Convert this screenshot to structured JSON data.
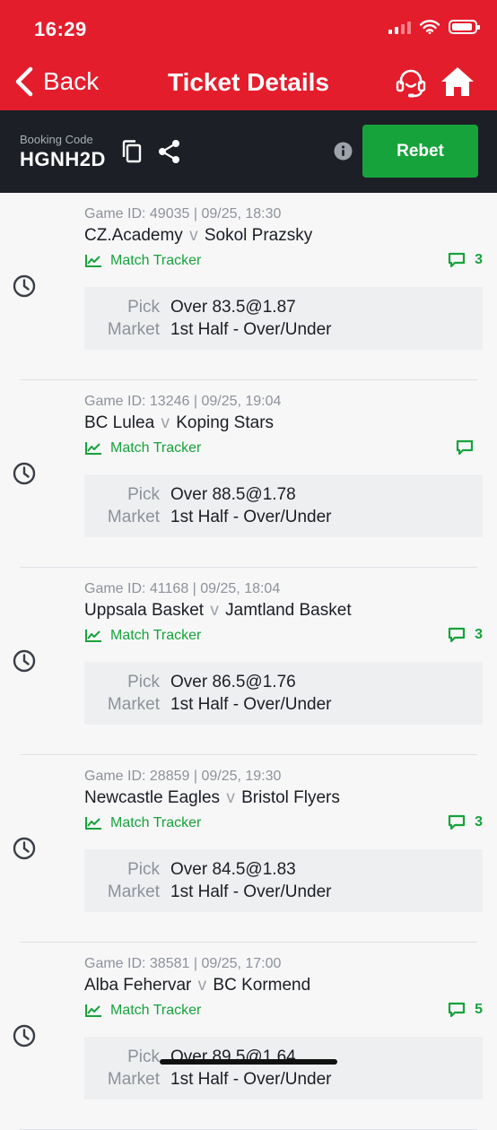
{
  "status_bar": {
    "time": "16:29"
  },
  "header": {
    "back_label": "Back",
    "title": "Ticket Details"
  },
  "booking": {
    "label": "Booking Code",
    "code": "HGNH2D",
    "rebet_label": "Rebet"
  },
  "bets": [
    {
      "meta": "Game ID: 49035 | 09/25, 18:30",
      "home": "CZ.Academy",
      "away": "Sokol Prazsky",
      "tracker": "Match Tracker",
      "comments": "3",
      "pick_label": "Pick",
      "pick": "Over 83.5@1.87",
      "market_label": "Market",
      "market": "1st Half - Over/Under"
    },
    {
      "meta": "Game ID: 13246 | 09/25, 19:04",
      "home": "BC Lulea",
      "away": "Koping Stars",
      "tracker": "Match Tracker",
      "comments": "",
      "pick_label": "Pick",
      "pick": "Over 88.5@1.78",
      "market_label": "Market",
      "market": "1st Half - Over/Under"
    },
    {
      "meta": "Game ID: 41168 | 09/25, 18:04",
      "home": "Uppsala Basket",
      "away": "Jamtland Basket",
      "tracker": "Match Tracker",
      "comments": "3",
      "pick_label": "Pick",
      "pick": "Over 86.5@1.76",
      "market_label": "Market",
      "market": "1st Half - Over/Under"
    },
    {
      "meta": "Game ID: 28859 | 09/25, 19:30",
      "home": "Newcastle Eagles",
      "away": "Bristol Flyers",
      "tracker": "Match Tracker",
      "comments": "3",
      "pick_label": "Pick",
      "pick": "Over 84.5@1.83",
      "market_label": "Market",
      "market": "1st Half - Over/Under"
    },
    {
      "meta": "Game ID: 38581 | 09/25, 17:00",
      "home": "Alba Fehervar",
      "away": "BC Kormend",
      "tracker": "Match Tracker",
      "comments": "5",
      "pick_label": "Pick",
      "pick": "Over 89.5@1.64",
      "market_label": "Market",
      "market": "1st Half - Over/Under"
    }
  ],
  "versus": "v",
  "colors": {
    "brand_red": "#e41d2c",
    "accent_green": "#17a33b",
    "dark_bar": "#1c1f26"
  }
}
